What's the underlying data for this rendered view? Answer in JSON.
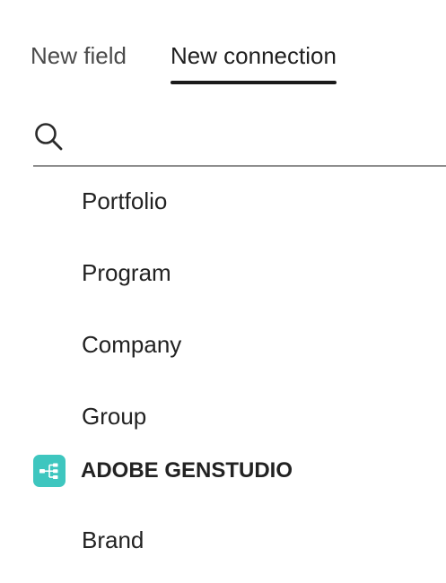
{
  "tabs": [
    {
      "label": "New field",
      "selected": false
    },
    {
      "label": "New connection",
      "selected": true
    }
  ],
  "search": {
    "value": "",
    "placeholder": "",
    "icon": "search-icon"
  },
  "list": {
    "items": [
      {
        "label": "Portfolio"
      },
      {
        "label": "Program"
      },
      {
        "label": "Company"
      },
      {
        "label": "Group"
      }
    ],
    "sections": [
      {
        "title": "ADOBE GENSTUDIO",
        "icon": "hierarchy-icon",
        "icon_color": "#3ec6bf",
        "items": [
          {
            "label": "Brand"
          }
        ]
      }
    ]
  }
}
